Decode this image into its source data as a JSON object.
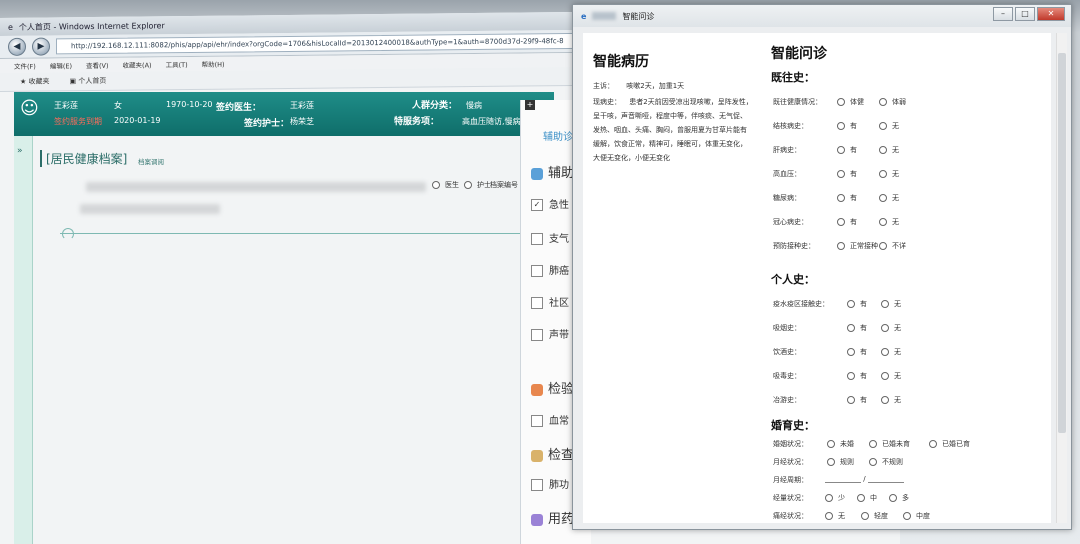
{
  "ie": {
    "window_title": "个人首页 - Windows Internet Explorer",
    "url": "http://192.168.12.111:8082/phis/app/api/ehr/index?orgCode=1706&hisLocalId=2013012400018&authType=1&auth=8700d37d-29f9-48fc-8",
    "menu": [
      "文件(F)",
      "编辑(E)",
      "查看(V)",
      "收藏夹(A)",
      "工具(T)",
      "帮助(H)"
    ],
    "favorites": [
      "收藏夹",
      "个人首页"
    ]
  },
  "patient_bar": {
    "name": "王彩莲",
    "sex": "女",
    "dob": "1970-10-20",
    "sign_doctor_label": "签约医生：",
    "sign_doctor": "王彩莲",
    "crowd_label": "人群分类：",
    "crowd": "慢病",
    "date": "2020-01-19",
    "sign_nurse_label": "签约护士：",
    "sign_nurse": "杨荣芝",
    "service_label": "特服务项：",
    "service": "高血压随访,慢病",
    "alert": "签约服务到期"
  },
  "record": {
    "title": "[居民健康档案]",
    "subtitle": "档案调阅",
    "radio_doctor": "医生",
    "radio_nurse": "护士",
    "radio_other": "档案编号"
  },
  "middle_panel": {
    "tab": "辅助诊",
    "section1": "辅助",
    "items": [
      "急性",
      "支气",
      "肺癌",
      "社区",
      "声带"
    ],
    "section2": "检验",
    "item_blood": "血常",
    "section3": "检查",
    "item_lung": "肺功",
    "section4": "用药推荐"
  },
  "dialog": {
    "title": "智能问诊",
    "left": {
      "heading": "智能病历",
      "complaint_label": "主诉：",
      "complaint": "咳嗽2天，加重1天",
      "history_label": "现病史：",
      "history": "患者2天前因受凉出现咳嗽，呈阵发性，呈干咳，声音嘶哑，程度中等，伴咳痰、无气促、发热、咽血、头痛、胸闷，曾服用夏为甘草片能有缓解，饮食正常，精神可，睡眠可，体重无变化，大便无变化，小便无变化"
    },
    "right": {
      "heading": "智能问诊",
      "past_history": "既往史：",
      "past_rows": [
        {
          "q": "既往健康情况：",
          "opts": [
            "体健",
            "体弱"
          ]
        },
        {
          "q": "结核病史：",
          "opts": [
            "有",
            "无"
          ]
        },
        {
          "q": "肝病史：",
          "opts": [
            "有",
            "无"
          ]
        },
        {
          "q": "高血压：",
          "opts": [
            "有",
            "无"
          ]
        },
        {
          "q": "糖尿病：",
          "opts": [
            "有",
            "无"
          ]
        },
        {
          "q": "冠心病史：",
          "opts": [
            "有",
            "无"
          ]
        },
        {
          "q": "预防接种史：",
          "opts": [
            "正常接种",
            "不详"
          ]
        }
      ],
      "personal_history": "个人史：",
      "personal_rows": [
        {
          "q": "疫水疫区接触史：",
          "opts": [
            "有",
            "无"
          ]
        },
        {
          "q": "吸烟史：",
          "opts": [
            "有",
            "无"
          ]
        },
        {
          "q": "饮酒史：",
          "opts": [
            "有",
            "无"
          ]
        },
        {
          "q": "吸毒史：",
          "opts": [
            "有",
            "无"
          ]
        },
        {
          "q": "冶游史：",
          "opts": [
            "有",
            "无"
          ]
        }
      ],
      "marriage_history": "婚育史：",
      "marriage_rows": [
        {
          "q": "婚姻状况：",
          "opts": [
            "未婚",
            "已婚未育",
            "已婚已育"
          ]
        },
        {
          "q": "月经状况：",
          "opts": [
            "规则",
            "不规则"
          ]
        }
      ],
      "period_label": "月经周期：",
      "period_sep": "/",
      "amount_row": {
        "q": "经量状况：",
        "opts": [
          "少",
          "中",
          "多"
        ]
      },
      "pain_row": {
        "q": "痛经状况：",
        "opts": [
          "无",
          "轻度",
          "中度"
        ]
      }
    }
  }
}
